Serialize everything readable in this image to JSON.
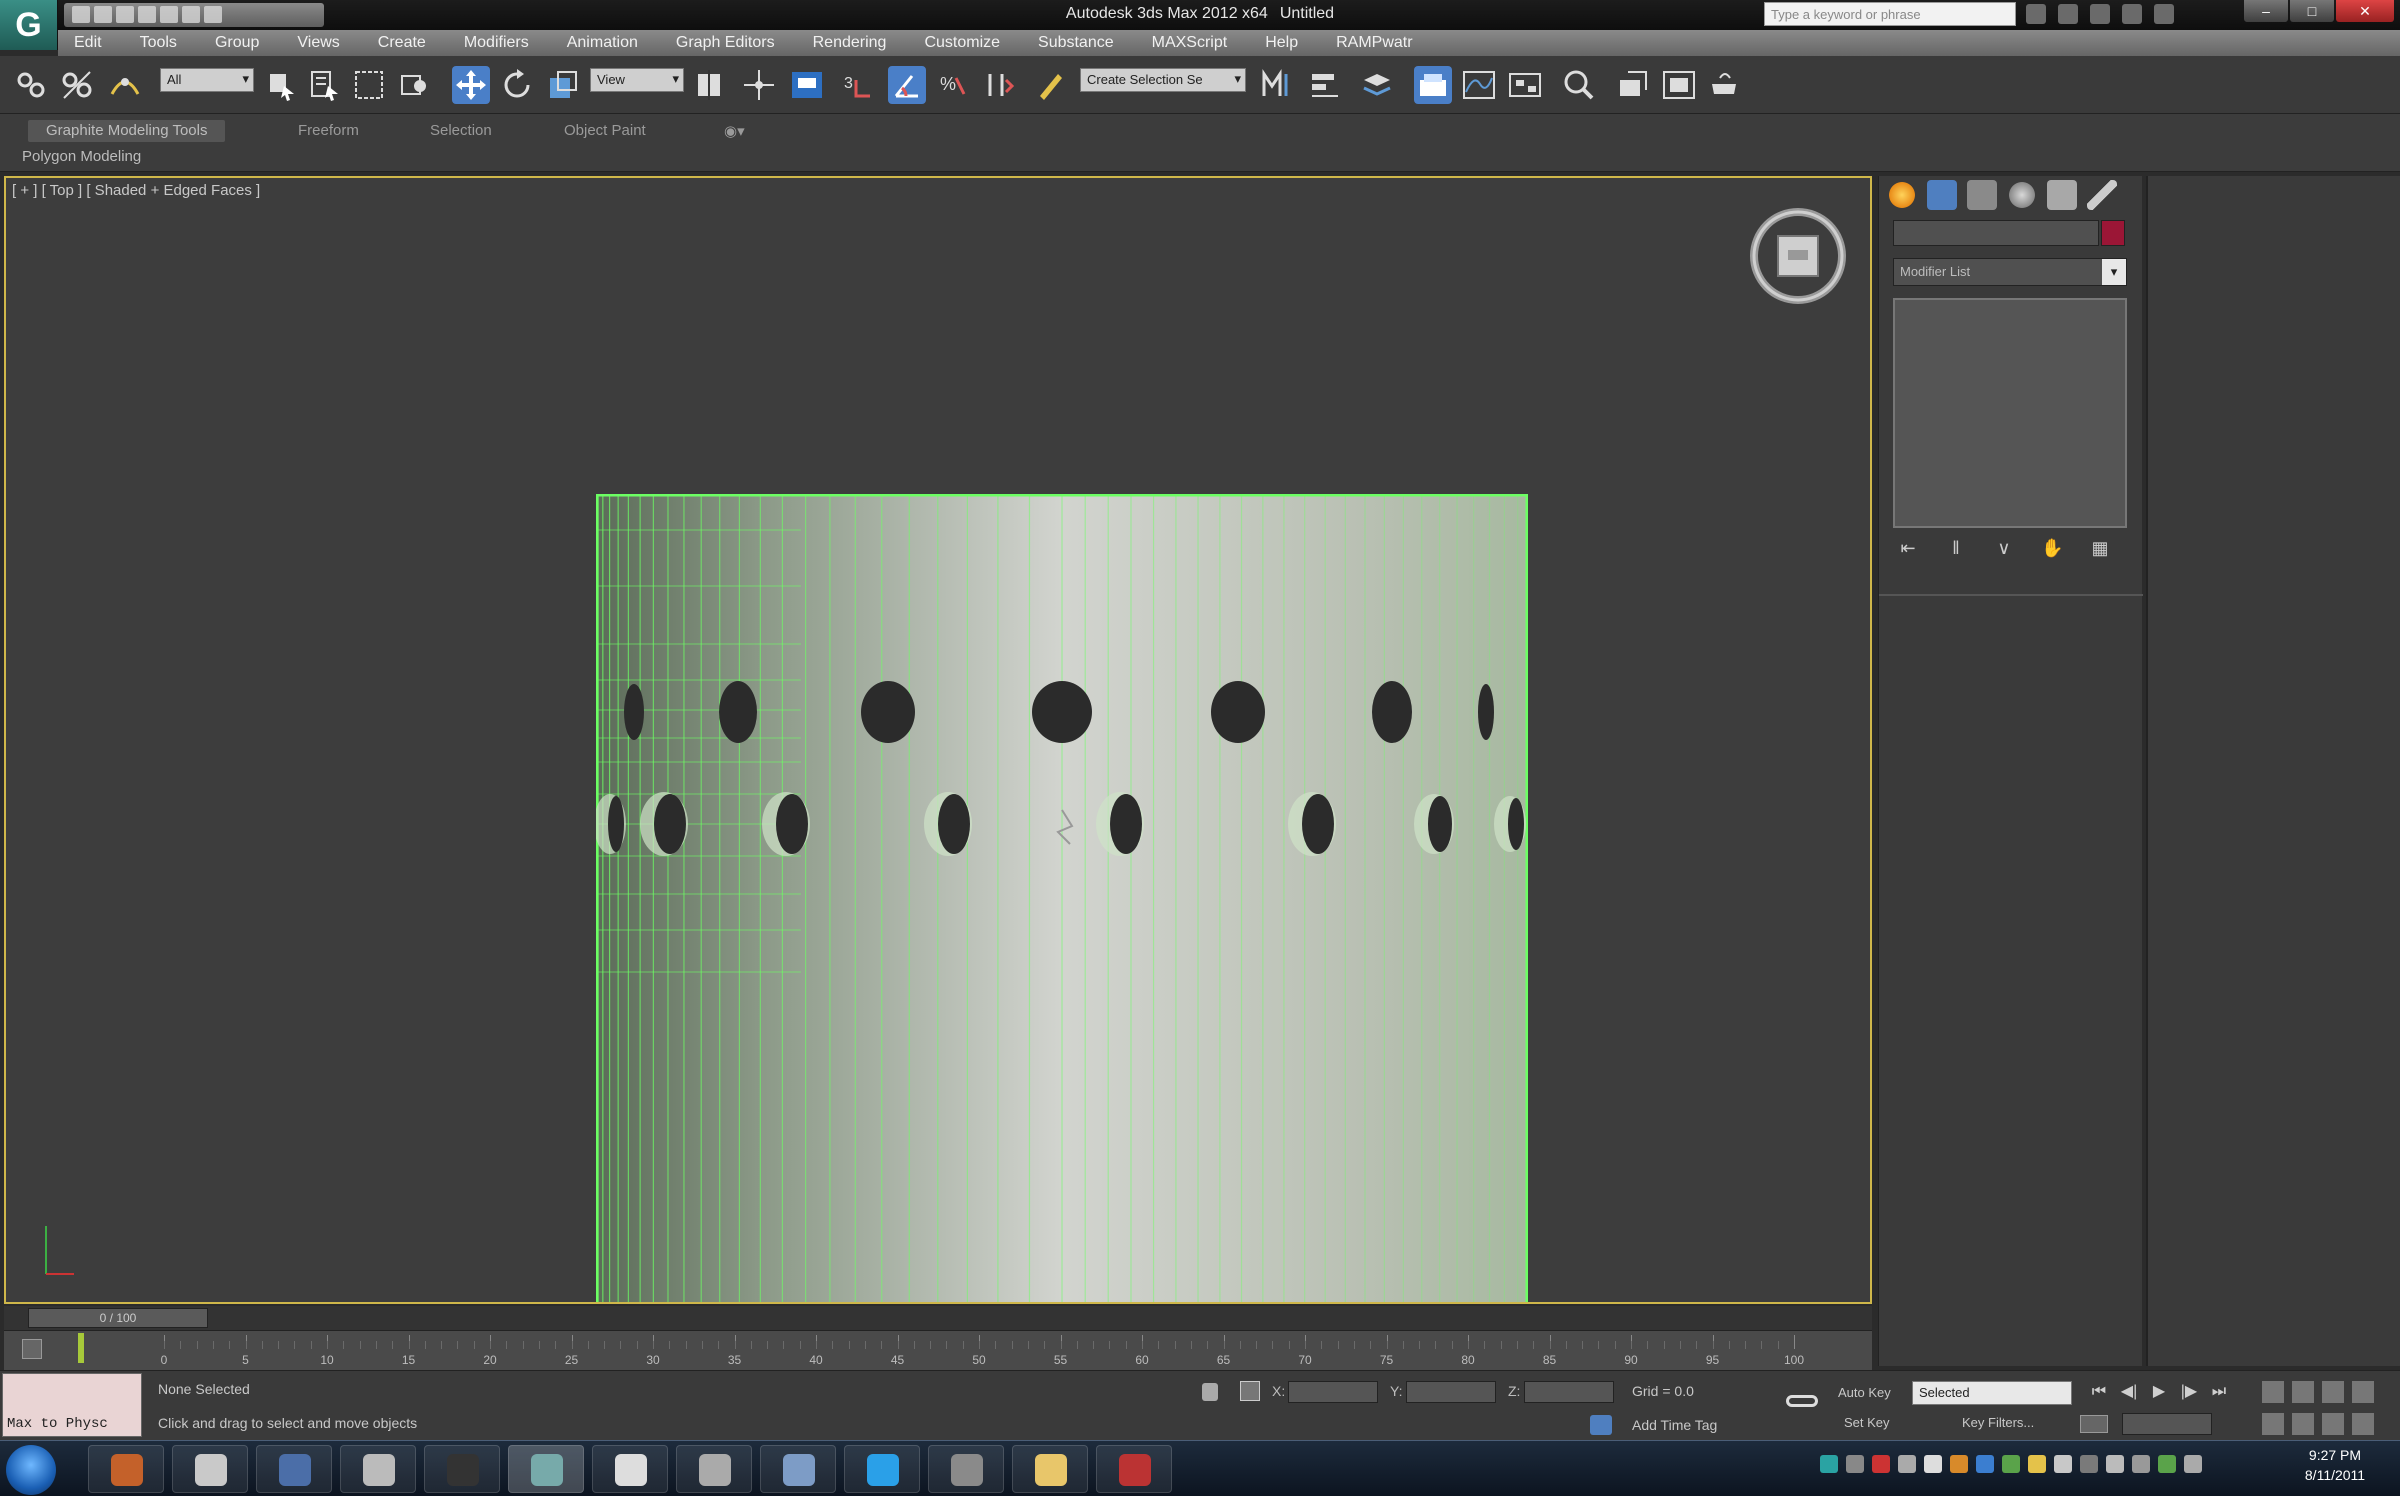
{
  "window": {
    "app_title": "Autodesk 3ds Max 2012 x64",
    "doc_title": "Untitled",
    "search_placeholder": "Type a keyword or phrase",
    "app_logo": "G",
    "controls": [
      "–",
      "□",
      "✕"
    ]
  },
  "menu": [
    "Edit",
    "Tools",
    "Group",
    "Views",
    "Create",
    "Modifiers",
    "Animation",
    "Graph Editors",
    "Rendering",
    "Customize",
    "Substance",
    "MAXScript",
    "Help",
    "RAMPwatr"
  ],
  "toolbar": {
    "selection_filter": "All",
    "ref_coord": "View",
    "named_selection": "Create Selection Se"
  },
  "ribbon": {
    "tabs": [
      "Graphite Modeling Tools",
      "Freeform",
      "Selection",
      "Object Paint"
    ],
    "active_tab": "Graphite Modeling Tools",
    "sub_panel": "Polygon Modeling"
  },
  "viewport": {
    "label": "[ + ] [ Top ] [ Shaded + Edged Faces ]",
    "selection_color": "#6cff63",
    "border_color": "#cfb74a"
  },
  "command_panel": {
    "modifier_list": "Modifier List",
    "object_color": "#9b1636",
    "tabs": [
      "create-icon",
      "modify-icon",
      "hierarchy-icon",
      "motion-icon",
      "display-icon",
      "utilities-icon"
    ],
    "stack_buttons": [
      "⇤",
      "‖",
      "∨",
      "✋",
      "▦"
    ]
  },
  "timeline": {
    "frame_readout": "0 / 100",
    "ticks": [
      "0",
      "5",
      "10",
      "15",
      "20",
      "25",
      "30",
      "35",
      "40",
      "45",
      "50",
      "55",
      "60",
      "65",
      "70",
      "75",
      "80",
      "85",
      "90",
      "95",
      "100"
    ]
  },
  "status": {
    "maxscript": "Max to Physc",
    "selection": "None Selected",
    "prompt": "Click and drag to select and move objects",
    "x_label": "X:",
    "y_label": "Y:",
    "z_label": "Z:",
    "grid": "Grid = 0.0",
    "add_time_tag": "Add Time Tag",
    "auto_key": "Auto Key",
    "set_key": "Set Key",
    "selected": "Selected",
    "key_filters": "Key Filters...",
    "playback": [
      "⏮",
      "◀|",
      "▶",
      "|▶",
      "⏭"
    ]
  },
  "taskbar": {
    "apps": [
      "firefox-icon",
      "chrome-icon",
      "photoshop-icon",
      "search-icon",
      "media-player-icon",
      "3dsmax-icon",
      "zbrush-icon",
      "substance-icon",
      "explorer-window-icon",
      "skype-icon",
      "steam-icon",
      "folder-icon",
      "acrobat-icon"
    ],
    "active_app": "3dsmax-icon",
    "time": "9:27 PM",
    "date": "8/11/2011"
  }
}
